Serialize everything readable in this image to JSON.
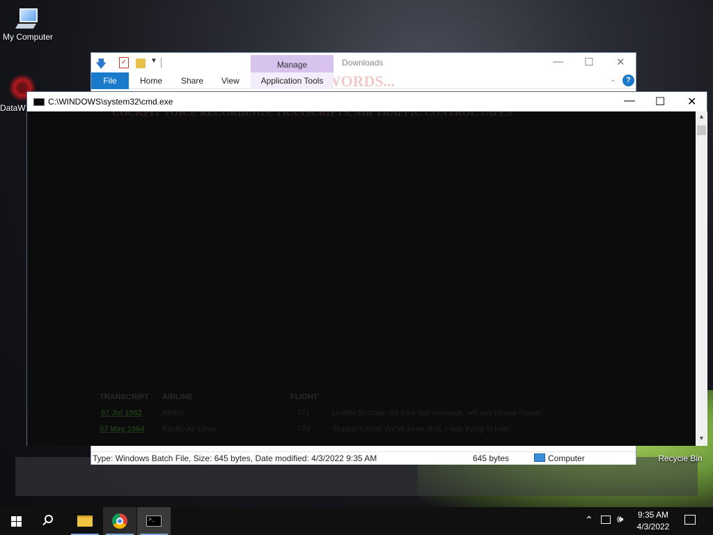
{
  "desktop": {
    "icons": [
      {
        "label": "My Computer"
      },
      {
        "label": "DataW"
      },
      {
        "label": "Recycle Bin"
      }
    ]
  },
  "explorer": {
    "window_title": "Downloads",
    "contextual_tab_group": "Manage",
    "ribbon_tabs": [
      "File",
      "Home",
      "Share",
      "View",
      "Application Tools"
    ],
    "help_glyph": "?",
    "status": {
      "details": "Type: Windows Batch File, Size: 645 bytes, Date modified: 4/3/2022 9:35 AM",
      "size": "645 bytes",
      "location": "Computer"
    }
  },
  "cmd": {
    "title": "C:\\WINDOWS\\system32\\cmd.exe"
  },
  "background_page": {
    "ribbon_text": "...WORDS...",
    "banner": "COCKPIT VOICE RECORDINGS, TRANSCRIPTS, AIR TRAFFIC CONTROL TAPES",
    "table_headers": [
      "TRANSCRIPT",
      "AIRLINE",
      "FLIGHT"
    ],
    "rows": [
      {
        "date": "07 Jul 1962",
        "airline": "Alitalia",
        "flight": "771",
        "quote": "Unable to make out your last message, will you please repeat."
      },
      {
        "date": "07 May 1964",
        "airline": "Pacific Air Lines",
        "flight": "773",
        "quote": "Skipper's shot!  We've been shot.  I was trying to help."
      }
    ]
  },
  "taskbar": {
    "pinned": [
      "start-icon",
      "search-icon",
      "file-explorer-icon",
      "chrome-icon",
      "cmd-icon"
    ],
    "time": "9:35 AM",
    "date": "4/3/2022"
  },
  "colors": {
    "ribbon_file_tab": "#1979ca",
    "manage_tab": "#d8c2ee",
    "cmd_background": "#0c0c0c",
    "taskbar": "#101010"
  }
}
